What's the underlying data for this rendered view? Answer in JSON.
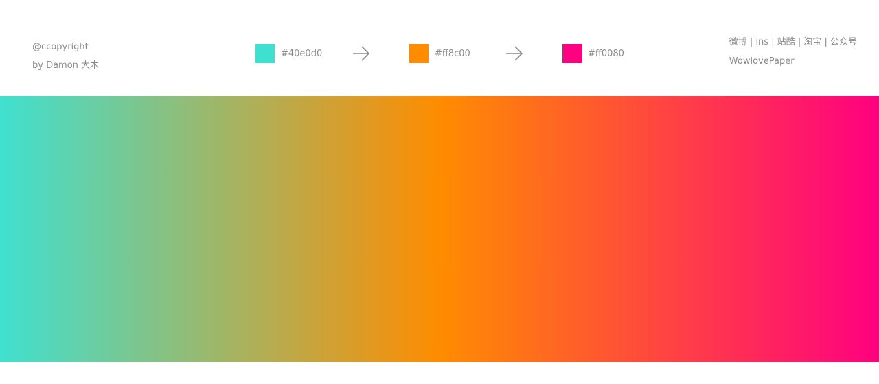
{
  "credits": {
    "copyright": "@ccopyright",
    "author": "by Damon 大木"
  },
  "palette": {
    "colors": [
      {
        "hex": "#40e0d0",
        "label": "#40e0d0"
      },
      {
        "hex": "#ff8c00",
        "label": "#ff8c00"
      },
      {
        "hex": "#ff0080",
        "label": "#ff0080"
      }
    ],
    "arrow_icon": "arrow-right-icon"
  },
  "social": {
    "links": "微博 | ins | 站酷 | 淘宝  | 公众号",
    "brand": "WowlovePaper"
  }
}
